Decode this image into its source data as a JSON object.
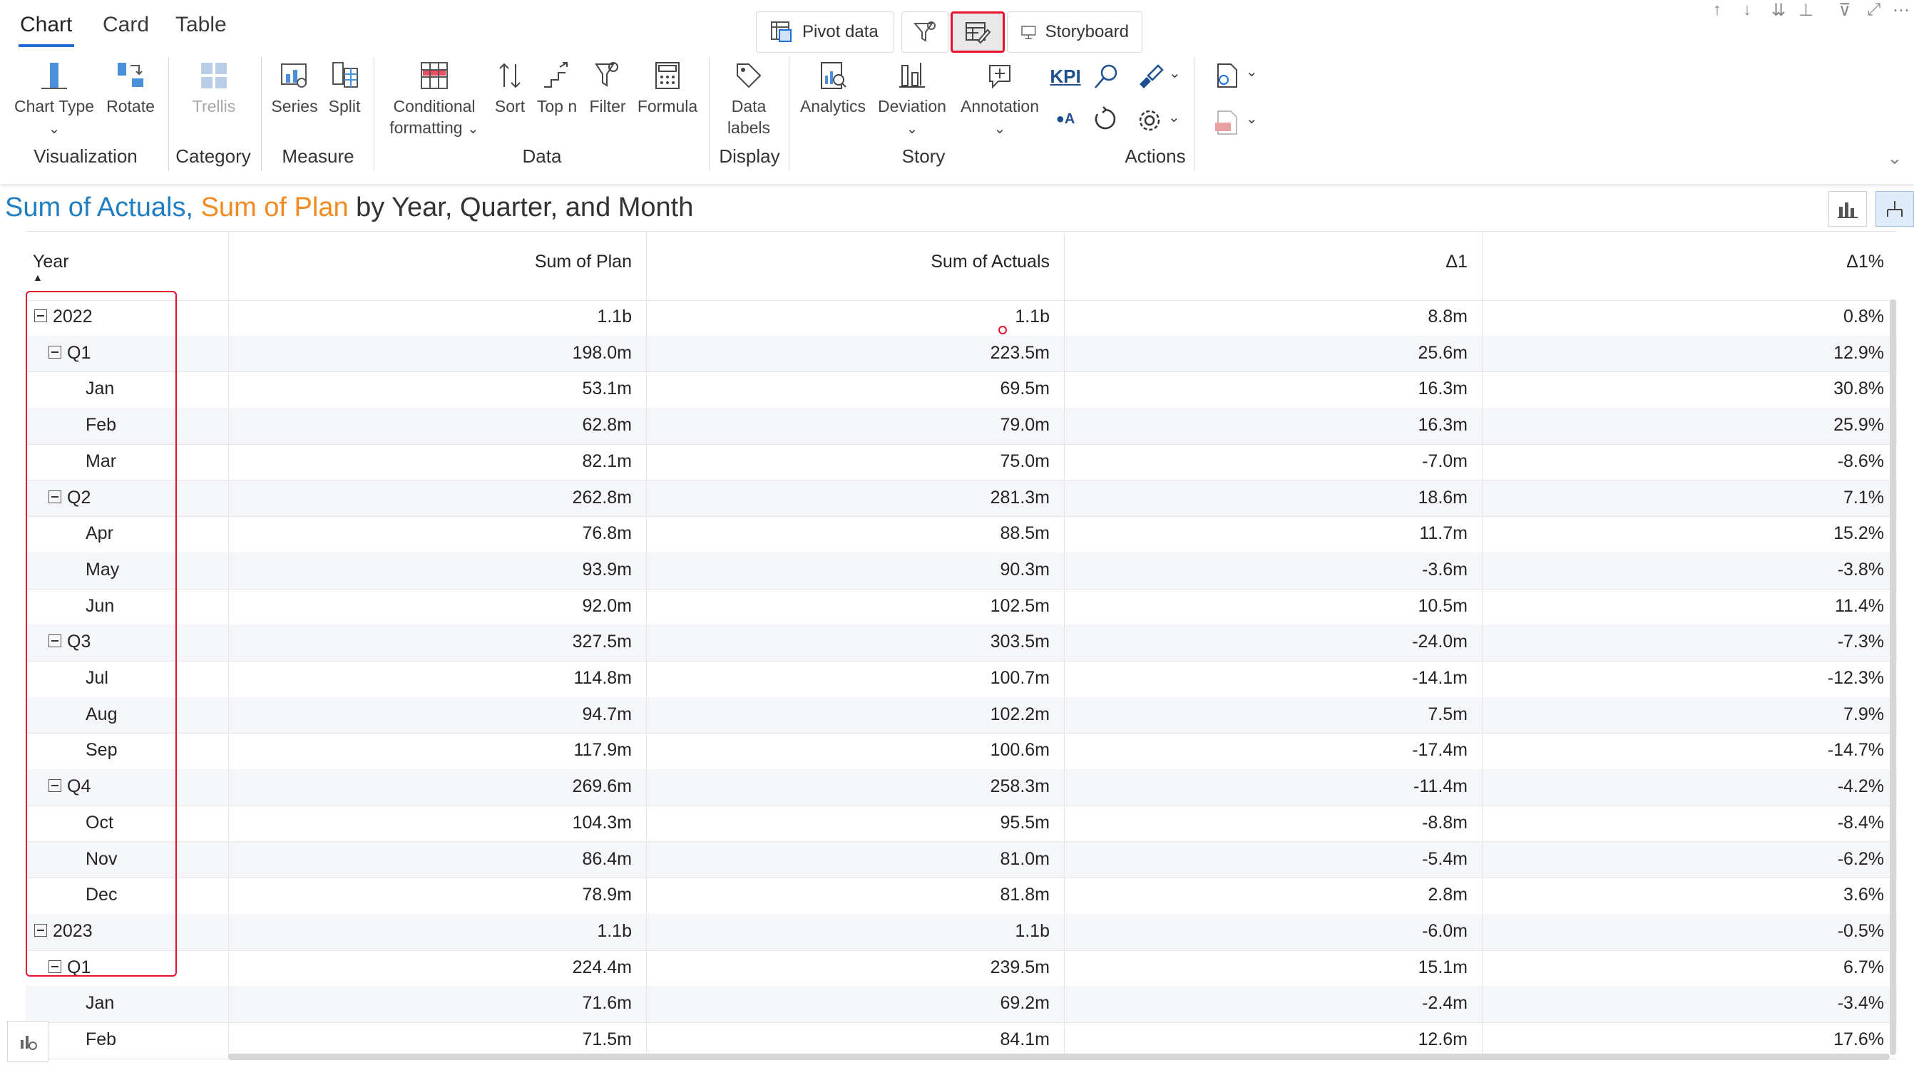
{
  "ribbon": {
    "tabs": [
      "Chart",
      "Card",
      "Table"
    ],
    "top_buttons": {
      "pivot": "Pivot data",
      "storyboard": "Storyboard"
    },
    "buttons": {
      "chart_type": "Chart Type",
      "rotate": "Rotate",
      "trellis": "Trellis",
      "series": "Series",
      "split": "Split",
      "conditional_1": "Conditional",
      "conditional_2": "formatting",
      "sort": "Sort",
      "topn": "Top n",
      "filter": "Filter",
      "formula": "Formula",
      "data_labels_1": "Data",
      "data_labels_2": "labels",
      "analytics": "Analytics",
      "deviation": "Deviation",
      "annotation": "Annotation",
      "kpi": "KPI"
    },
    "groups": {
      "visualization": "Visualization",
      "category": "Category",
      "measure": "Measure",
      "data": "Data",
      "display": "Display",
      "story": "Story",
      "actions": "Actions"
    }
  },
  "title": {
    "actuals": "Sum of Actuals",
    "comma": ",",
    "plan": " Sum of Plan",
    "rest": " by Year, Quarter, and Month"
  },
  "table": {
    "headers": {
      "year": "Year",
      "plan": "Sum of Plan",
      "actuals": "Sum of Actuals",
      "d1": "Δ1",
      "d1pct": "Δ1%"
    },
    "rows": [
      {
        "label": "2022",
        "level": 0,
        "plan": "1.1b",
        "actuals": "1.1b",
        "d1": "8.8m",
        "d1pct": "0.8%"
      },
      {
        "label": "Q1",
        "level": 1,
        "plan": "198.0m",
        "actuals": "223.5m",
        "d1": "25.6m",
        "d1pct": "12.9%"
      },
      {
        "label": "Jan",
        "level": 2,
        "plan": "53.1m",
        "actuals": "69.5m",
        "d1": "16.3m",
        "d1pct": "30.8%"
      },
      {
        "label": "Feb",
        "level": 2,
        "plan": "62.8m",
        "actuals": "79.0m",
        "d1": "16.3m",
        "d1pct": "25.9%"
      },
      {
        "label": "Mar",
        "level": 2,
        "plan": "82.1m",
        "actuals": "75.0m",
        "d1": "-7.0m",
        "d1pct": "-8.6%"
      },
      {
        "label": "Q2",
        "level": 1,
        "plan": "262.8m",
        "actuals": "281.3m",
        "d1": "18.6m",
        "d1pct": "7.1%"
      },
      {
        "label": "Apr",
        "level": 2,
        "plan": "76.8m",
        "actuals": "88.5m",
        "d1": "11.7m",
        "d1pct": "15.2%"
      },
      {
        "label": "May",
        "level": 2,
        "plan": "93.9m",
        "actuals": "90.3m",
        "d1": "-3.6m",
        "d1pct": "-3.8%"
      },
      {
        "label": "Jun",
        "level": 2,
        "plan": "92.0m",
        "actuals": "102.5m",
        "d1": "10.5m",
        "d1pct": "11.4%"
      },
      {
        "label": "Q3",
        "level": 1,
        "plan": "327.5m",
        "actuals": "303.5m",
        "d1": "-24.0m",
        "d1pct": "-7.3%"
      },
      {
        "label": "Jul",
        "level": 2,
        "plan": "114.8m",
        "actuals": "100.7m",
        "d1": "-14.1m",
        "d1pct": "-12.3%"
      },
      {
        "label": "Aug",
        "level": 2,
        "plan": "94.7m",
        "actuals": "102.2m",
        "d1": "7.5m",
        "d1pct": "7.9%"
      },
      {
        "label": "Sep",
        "level": 2,
        "plan": "117.9m",
        "actuals": "100.6m",
        "d1": "-17.4m",
        "d1pct": "-14.7%"
      },
      {
        "label": "Q4",
        "level": 1,
        "plan": "269.6m",
        "actuals": "258.3m",
        "d1": "-11.4m",
        "d1pct": "-4.2%"
      },
      {
        "label": "Oct",
        "level": 2,
        "plan": "104.3m",
        "actuals": "95.5m",
        "d1": "-8.8m",
        "d1pct": "-8.4%"
      },
      {
        "label": "Nov",
        "level": 2,
        "plan": "86.4m",
        "actuals": "81.0m",
        "d1": "-5.4m",
        "d1pct": "-6.2%"
      },
      {
        "label": "Dec",
        "level": 2,
        "plan": "78.9m",
        "actuals": "81.8m",
        "d1": "2.8m",
        "d1pct": "3.6%"
      },
      {
        "label": "2023",
        "level": 0,
        "plan": "1.1b",
        "actuals": "1.1b",
        "d1": "-6.0m",
        "d1pct": "-0.5%"
      },
      {
        "label": "Q1",
        "level": 1,
        "plan": "224.4m",
        "actuals": "239.5m",
        "d1": "15.1m",
        "d1pct": "6.7%"
      },
      {
        "label": "Jan",
        "level": 2,
        "plan": "71.6m",
        "actuals": "69.2m",
        "d1": "-2.4m",
        "d1pct": "-3.4%"
      },
      {
        "label": "Feb",
        "level": 2,
        "plan": "71.5m",
        "actuals": "84.1m",
        "d1": "12.6m",
        "d1pct": "17.6%"
      }
    ]
  },
  "colors": {
    "actuals": "#1f7ec1",
    "plan": "#f28a22",
    "highlight": "#e8112d",
    "accent": "#1e6fd6"
  },
  "icons": [
    "chart-type-icon",
    "rotate-icon",
    "trellis-icon",
    "series-icon",
    "split-icon",
    "conditional-formatting-icon",
    "sort-icon",
    "topn-icon",
    "filter-icon",
    "formula-icon",
    "data-labels-icon",
    "analytics-icon",
    "deviation-icon",
    "annotation-icon",
    "search-icon",
    "brush-icon",
    "refresh-icon",
    "settings-icon",
    "export-icon",
    "pdf-icon"
  ]
}
